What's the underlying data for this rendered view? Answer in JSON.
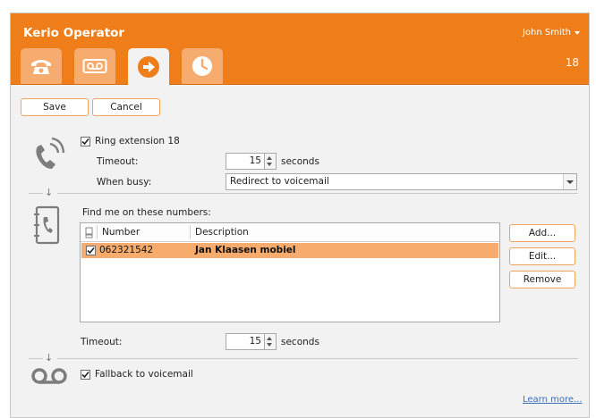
{
  "app": {
    "title": "Kerio Operator",
    "user": "John Smith",
    "extension": "18"
  },
  "tabs": [
    {
      "name": "phone",
      "icon": "phone-icon"
    },
    {
      "name": "voicemail",
      "icon": "voicemail-icon"
    },
    {
      "name": "forwarding",
      "icon": "forward-arrow-icon"
    },
    {
      "name": "schedule",
      "icon": "clock-icon"
    }
  ],
  "toolbar": {
    "save_label": "Save",
    "cancel_label": "Cancel"
  },
  "ring": {
    "checkbox_label": "Ring extension 18",
    "checked": true,
    "timeout_label": "Timeout:",
    "timeout_value": "15",
    "seconds_label": "seconds",
    "busy_label": "When busy:",
    "busy_value": "Redirect to voicemail"
  },
  "findme": {
    "title": "Find me on these numbers:",
    "columns": [
      "Number",
      "Description"
    ],
    "rows": [
      {
        "checked": true,
        "number": "062321542",
        "description": "Jan Klaasen mobiel"
      }
    ],
    "add_label": "Add...",
    "edit_label": "Edit...",
    "remove_label": "Remove",
    "timeout_label": "Timeout:",
    "timeout_value": "15",
    "seconds_label": "seconds"
  },
  "fallback": {
    "checkbox_label": "Fallback to voicemail",
    "checked": true
  },
  "footer": {
    "learn_more": "Learn more..."
  },
  "colors": {
    "accent": "#ef7d1a",
    "tab_inactive": "#f7ac6f",
    "selection": "#f7ab6d",
    "link": "#3a6fb8"
  }
}
